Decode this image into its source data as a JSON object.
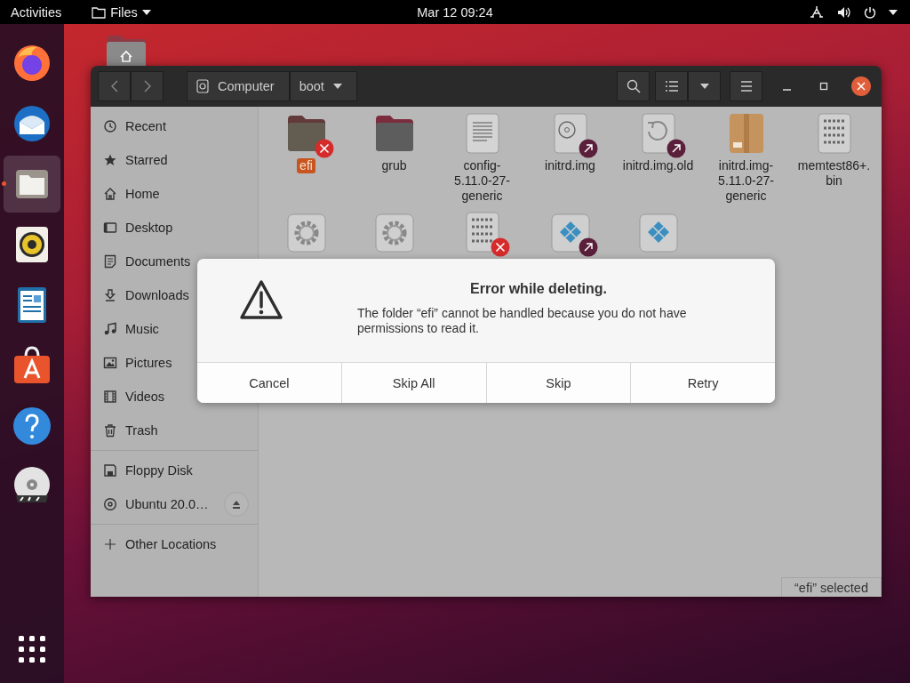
{
  "top_bar": {
    "activities": "Activities",
    "app_menu": "Files",
    "clock": "Mar 12  09:24"
  },
  "dock": [
    {
      "running": false
    },
    {
      "running": false
    },
    {
      "running": true
    },
    {
      "running": false
    },
    {
      "running": false
    },
    {
      "running": false
    },
    {
      "running": false
    },
    {
      "running": false
    }
  ],
  "path_bar": [
    {
      "label": "Computer",
      "kind": "drive"
    },
    {
      "label": "boot",
      "kind": "folder"
    }
  ],
  "sidebar": {
    "places": [
      "Recent",
      "Starred",
      "Home",
      "Desktop",
      "Documents",
      "Downloads",
      "Music",
      "Pictures",
      "Videos",
      "Trash"
    ],
    "devices": [
      {
        "label": "Floppy Disk",
        "ejectable": false
      },
      {
        "label": "Ubuntu 20.0…",
        "ejectable": true
      }
    ],
    "other": "Other Locations"
  },
  "files": [
    {
      "name": "efi",
      "kind": "folder",
      "unreadable": true,
      "symlink": false,
      "selected": true
    },
    {
      "name": "grub",
      "kind": "folder",
      "unreadable": false,
      "symlink": false,
      "selected": false
    },
    {
      "name": "config-5.11.0-27-generic",
      "kind": "text",
      "unreadable": false,
      "symlink": false,
      "selected": false
    },
    {
      "name": "initrd.img",
      "kind": "disc",
      "unreadable": false,
      "symlink": true,
      "selected": false
    },
    {
      "name": "initrd.img.old",
      "kind": "restore",
      "unreadable": false,
      "symlink": true,
      "selected": false
    },
    {
      "name": "initrd.img-5.11.0-27-generic",
      "kind": "archive",
      "unreadable": false,
      "symlink": false,
      "selected": false
    },
    {
      "name": "memtest86+.bin",
      "kind": "binary",
      "unreadable": false,
      "symlink": false,
      "selected": false
    },
    {
      "kind": "gear",
      "unreadable": false,
      "symlink": false,
      "selected": false
    },
    {
      "kind": "gear",
      "unreadable": false,
      "symlink": false,
      "selected": false
    },
    {
      "kind": "binary",
      "unreadable": true,
      "symlink": false,
      "selected": false
    },
    {
      "kind": "diamond",
      "unreadable": false,
      "symlink": true,
      "selected": false
    },
    {
      "kind": "diamond",
      "unreadable": false,
      "symlink": false,
      "selected": false
    }
  ],
  "status": "“efi” selected",
  "dialog": {
    "title": "Error while deleting.",
    "message": "The folder “efi” cannot be handled because you do not have permissions to read it.",
    "buttons": [
      "Cancel",
      "Skip All",
      "Skip",
      "Retry"
    ]
  }
}
